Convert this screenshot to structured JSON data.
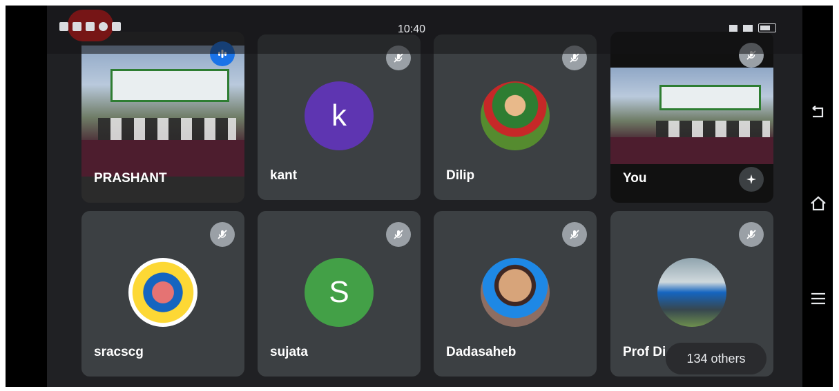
{
  "status_bar": {
    "time": "10:40"
  },
  "participants": [
    {
      "name": "PRASHANT",
      "type": "video"
    },
    {
      "name": "kant",
      "avatar_letter": "k",
      "avatar_color": "#5e35b1"
    },
    {
      "name": "Dilip",
      "type": "photo"
    },
    {
      "name": "You",
      "type": "video"
    },
    {
      "name": "sracscg",
      "type": "photo"
    },
    {
      "name": "sujata",
      "avatar_letter": "S",
      "avatar_color": "#43a047"
    },
    {
      "name": "Dadasaheb",
      "type": "photo"
    },
    {
      "name": "Prof Di",
      "type": "photo"
    }
  ],
  "others_label": "134 others",
  "icons": {
    "mute": "mic-off-icon",
    "speaking": "audio-level-icon",
    "effects": "sparkle-icon",
    "nav_back": "back-icon",
    "nav_home": "home-icon",
    "nav_menu": "menu-icon"
  }
}
